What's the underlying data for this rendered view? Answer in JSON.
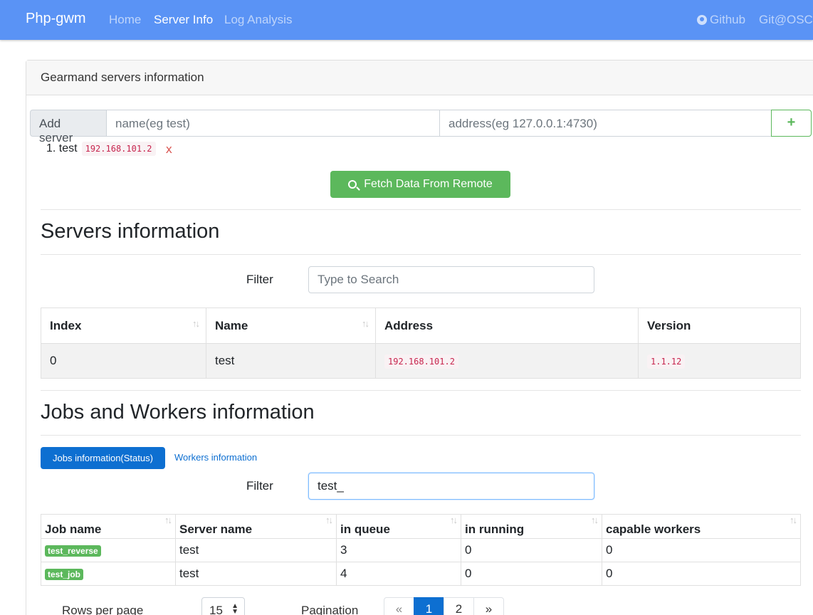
{
  "nav": {
    "brand": "Php-gwm",
    "links": [
      "Home",
      "Server Info",
      "Log Analysis"
    ],
    "active_link": "Server Info",
    "right": [
      "Github",
      "Git@OSC"
    ]
  },
  "card": {
    "header": "Gearmand servers information",
    "add_server": {
      "label": "Add server",
      "name_placeholder": "name(eg test)",
      "address_placeholder": "address(eg 127.0.0.1:4730)",
      "plus": "+"
    },
    "servers": [
      {
        "index": "1.",
        "name": "test",
        "address": "192.168.101.2",
        "remove": "x"
      }
    ],
    "fetch_button": "Fetch Data From Remote"
  },
  "servers_info": {
    "title": "Servers information",
    "filter_label": "Filter",
    "filter_placeholder": "Type to Search",
    "columns": [
      "Index",
      "Name",
      "Address",
      "Version"
    ],
    "rows": [
      {
        "index": "0",
        "name": "test",
        "address": "192.168.101.2",
        "version": "1.1.12"
      }
    ]
  },
  "jobs_info": {
    "title": "Jobs and Workers information",
    "tabs": [
      "Jobs information(Status)",
      "Workers information"
    ],
    "filter_label": "Filter",
    "filter_value": "test_",
    "columns": [
      "Job name",
      "Server name",
      "in queue",
      "in running",
      "capable workers"
    ],
    "rows": [
      {
        "job": "test_reverse",
        "server": "test",
        "queue": "3",
        "running": "0",
        "workers": "0"
      },
      {
        "job": "test_job",
        "server": "test",
        "queue": "4",
        "running": "0",
        "workers": "0"
      }
    ]
  },
  "footer": {
    "rows_label": "Rows per page",
    "rows_value": "15",
    "pagination_label": "Pagination",
    "pages": [
      "«",
      "1",
      "2",
      "»"
    ],
    "active_page": "1"
  },
  "colors": {
    "navbar": "#5a93f5",
    "primary": "#0d6fd1",
    "success": "#5cb85c",
    "code": "#c7254e"
  }
}
